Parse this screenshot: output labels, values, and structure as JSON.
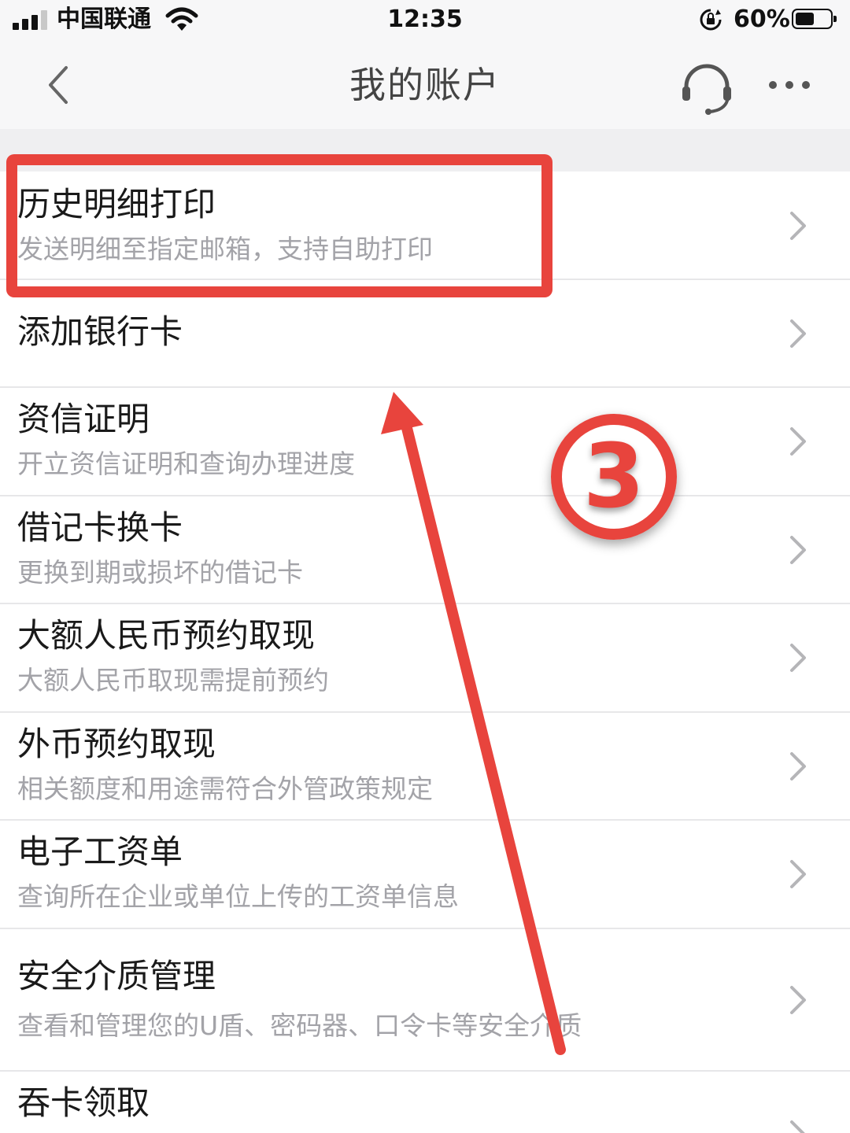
{
  "status_bar": {
    "carrier": "中国联通",
    "time": "12:35",
    "battery": "60%",
    "battery_level": 0.6
  },
  "nav": {
    "title": "我的账户"
  },
  "menu": [
    {
      "title": "历史明细打印",
      "subtitle": "发送明细至指定邮箱，支持自助打印"
    },
    {
      "title": "添加银行卡",
      "subtitle": ""
    },
    {
      "title": "资信证明",
      "subtitle": "开立资信证明和查询办理进度"
    },
    {
      "title": "借记卡换卡",
      "subtitle": "更换到期或损坏的借记卡"
    },
    {
      "title": "大额人民币预约取现",
      "subtitle": "大额人民币取现需提前预约"
    },
    {
      "title": "外币预约取现",
      "subtitle": "相关额度和用途需符合外管政策规定"
    },
    {
      "title": "电子工资单",
      "subtitle": "查询所在企业或单位上传的工资单信息"
    },
    {
      "title": "安全介质管理",
      "subtitle": "查看和管理您的U盾、密码器、口令卡等安全介质"
    },
    {
      "title": "吞卡领取",
      "subtitle": ""
    }
  ],
  "annotation": {
    "step": "③",
    "color": "#e8443d"
  }
}
